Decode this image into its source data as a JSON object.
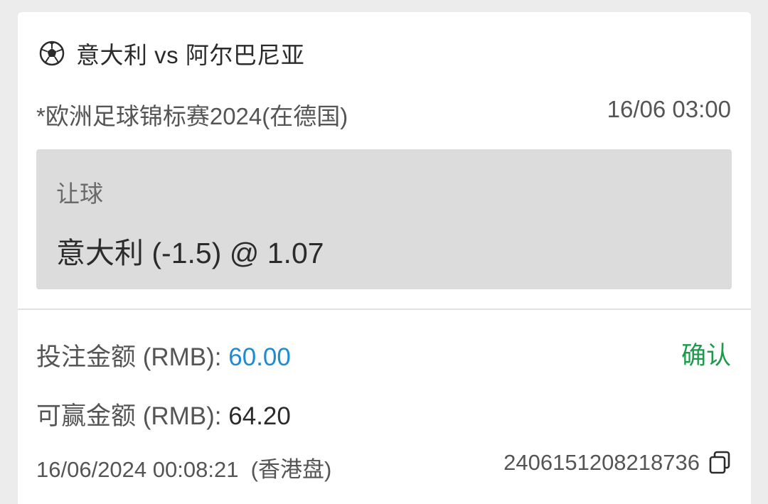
{
  "match": {
    "icon": "soccer-ball-icon",
    "title": "意大利 vs 阿尔巴尼亚"
  },
  "event": {
    "league": "*欧洲足球锦标赛2024(在德国)",
    "kickoff": "16/06 03:00"
  },
  "bet": {
    "market": "让球",
    "selection": "意大利 (-1.5) @ 1.07"
  },
  "stake": {
    "label": "投注金额 (RMB): ",
    "value": "60.00",
    "value_color": "#1f8bd1"
  },
  "confirm": {
    "label": "确认",
    "color": "#1e9a4c"
  },
  "winnings": {
    "label": "可赢金额 (RMB): ",
    "value": "64.20"
  },
  "footer": {
    "placed_time": "16/06/2024 00:08:21  (香港盘)",
    "ticket_id": "2406151208218736",
    "copy_icon": "copy-icon"
  }
}
